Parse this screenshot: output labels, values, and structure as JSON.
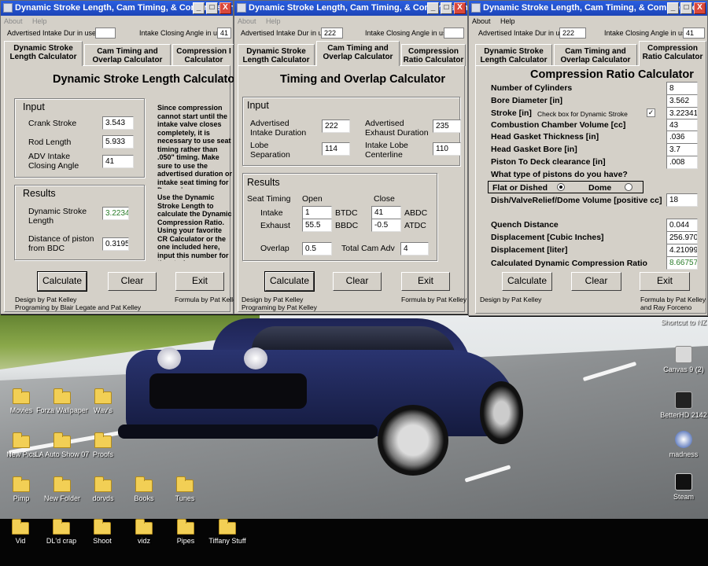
{
  "desktop": {
    "icons": [
      {
        "label": "Movies"
      },
      {
        "label": "Forza Wallpaper"
      },
      {
        "label": "Wav's"
      },
      {
        "label": "New Pics"
      },
      {
        "label": "LA Auto Show 07"
      },
      {
        "label": "Proofs"
      },
      {
        "label": "Pimp"
      },
      {
        "label": "New Folder"
      },
      {
        "label": "dorvds"
      },
      {
        "label": "Books"
      },
      {
        "label": "Tunes"
      },
      {
        "label": "Shortcut to NZ"
      },
      {
        "label": "Canvas 9 (2)"
      },
      {
        "label": "BetterHD 2142"
      },
      {
        "label": "madness"
      },
      {
        "label": "Steam"
      }
    ],
    "taskbar_items": [
      {
        "label": "Vid"
      },
      {
        "label": "DL'd crap"
      },
      {
        "label": "Shoot"
      },
      {
        "label": "vidz"
      },
      {
        "label": "Pipes"
      },
      {
        "label": "Tiffany Stuff"
      }
    ]
  },
  "common": {
    "window_title": "Dynamic Stroke Length, Cam Timing, & Compression ...",
    "window_title_3": "Dynamic Stroke Length, Cam Timing, & Compression",
    "menu_about": "About",
    "menu_help": "Help",
    "adv_intake_dur_label": "Advertised Intake Dur in use",
    "intake_close_angle_label": "Intake Closing Angle in use",
    "tabs": [
      "Dynamic Stroke Length Calculator",
      "Cam Timing and Overlap Calculator",
      "Compression Ratio Calculator"
    ],
    "tab_short_3": "Compression I Calculator",
    "calculate": "Calculate",
    "clear": "Clear",
    "exit": "Exit",
    "design": "Design by Pat Kelley",
    "formula": "Formula by Pat Kelley",
    "min_glyph": "_",
    "max_glyph": "□",
    "close_glyph": "X"
  },
  "win1": {
    "adv_intake_dur": "",
    "intake_close_angle": "41",
    "heading": "Dynamic Stroke Length Calculator",
    "input_title": "Input",
    "crank_stroke_label": "Crank Stroke",
    "crank_stroke": "3.543",
    "rod_length_label": "Rod Length",
    "rod_length": "5.933",
    "adv_intake_label": "ADV Intake Closing Angle",
    "adv_intake": "41",
    "results_title": "Results",
    "dyn_stroke_label": "Dynamic Stroke Length",
    "dyn_stroke": "3.2234",
    "distance_label": "Distance of piston from BDC",
    "distance": "0.3195",
    "note1": "Since compression cannot start until the intake valve closes completely, it is necessary to use seat timing rather than .050\" timing. Make sure to use the advertised duration or intake seat timing for Dynamic Compression Ratio",
    "note2": "Use the Dynamic Stroke Length to calculate the Dynamic Compression Ratio. Using your favorite CR Calculator or the one included here, input this number for the stroke.",
    "programming": "Programing by Blair Legate and Pat Kelley"
  },
  "win2": {
    "adv_intake_dur": "222",
    "intake_close_angle": "",
    "heading": "Timing and Overlap Calculator",
    "input_title": "Input",
    "adv_intake_dur_label": "Advertised Intake Duration",
    "adv_intake_dur_val": "222",
    "adv_exhaust_label": "Advertised Exhaust Duration",
    "adv_exhaust_val": "235",
    "lobe_sep_label": "Lobe Separation",
    "lobe_sep_val": "114",
    "intake_cl_label": "Intake Lobe Centerline",
    "intake_cl_val": "110",
    "results_title": "Results",
    "seat_timing": "Seat Timing",
    "open": "Open",
    "close": "Close",
    "intake": "Intake",
    "exhaust": "Exhaust",
    "intake_open": "1",
    "btdc": "BTDC",
    "intake_close": "41",
    "abdc": "ABDC",
    "exhaust_open": "55.5",
    "bbdc": "BBDC",
    "exhaust_close": "-0.5",
    "atdc": "ATDC",
    "overlap_label": "Overlap",
    "overlap": "0.5",
    "total_cam_label": "Total Cam Adv",
    "total_cam": "4",
    "programming": "Programing by Pat Kelley"
  },
  "win3": {
    "adv_intake_dur": "222",
    "intake_close_angle": "41",
    "heading": "Compression Ratio Calculator",
    "cylinders_label": "Number of Cylinders",
    "cylinders": "8",
    "bore_label": "Bore Diameter [in]",
    "bore": "3.562",
    "stroke_label": "Stroke [in]",
    "stroke_check_label": "Check box for Dynamic Stroke",
    "stroke_checked": "✓",
    "stroke": "3.223413",
    "chamber_label": "Combustion Chamber Volume [cc]",
    "chamber": "43",
    "gasket_thick_label": "Head Gasket Thickness [in]",
    "gasket_thick": ".036",
    "gasket_bore_label": "Head Gasket Bore [in]",
    "gasket_bore": "3.7",
    "deck_label": "Piston To Deck clearance [in]",
    "deck": ".008",
    "piston_q": "What type of pistons do you have?",
    "flat": "Flat or Dished",
    "dome": "Dome",
    "dish_label": "Dish/ValveRelief/Dome Volume [positive cc]",
    "dish": "18",
    "quench_label": "Quench Distance",
    "quench": "0.044",
    "disp_ci_label": "Displacement [Cubic Inches]",
    "disp_ci": "256.9707",
    "disp_l_label": "Displacement [liter]",
    "disp_l": "4.210996",
    "dcr_label": "Calculated Dynamic Compression Ratio",
    "dcr": "8.66757",
    "formula": "Formula by Pat Kelley and Ray Forceno"
  },
  "colors": {
    "titlebar": "#2456d6",
    "window_bg": "#d4d0c8",
    "result_green": "#2a7d2a"
  }
}
